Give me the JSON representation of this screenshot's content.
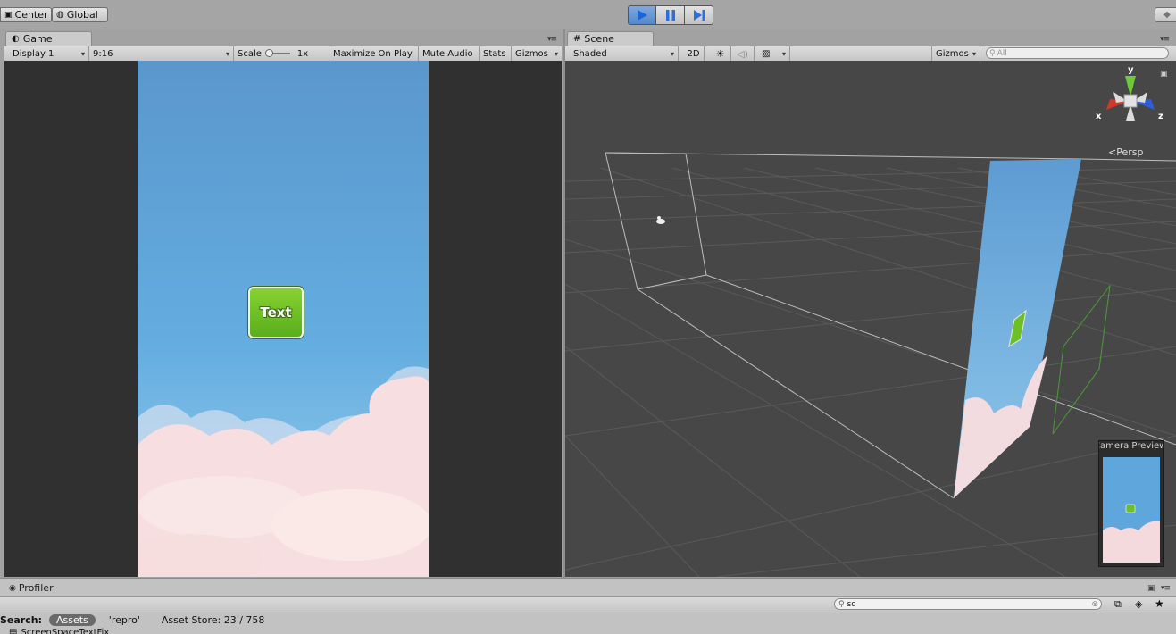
{
  "top_toolbar": {
    "pivot_label": "Center",
    "space_label": "Global",
    "play_icon": "play-icon",
    "pause_icon": "pause-icon",
    "step_icon": "step-icon",
    "accent_color": "#2f7de1"
  },
  "game_panel": {
    "tab_label": "Game",
    "display_label": "Display 1",
    "aspect_label": "9:16",
    "scale_label": "Scale",
    "scale_value": "1x",
    "maximize_label": "Maximize On Play",
    "mute_label": "Mute Audio",
    "stats_label": "Stats",
    "gizmos_label": "Gizmos",
    "button_text": "Text",
    "sky_color": "#5ea6dc",
    "button_color": "#6cbf26"
  },
  "scene_panel": {
    "tab_label": "Scene",
    "shading_label": "Shaded",
    "mode_2d_label": "2D",
    "gizmos_label": "Gizmos",
    "search_placeholder": "All",
    "persp_label": "Persp",
    "axis_y": "y",
    "axis_x": "x",
    "axis_z": "z",
    "camera_preview_label": "Camera Preview",
    "bg_color": "#474747"
  },
  "bottom_panel": {
    "tab_label": "Profiler",
    "search_value": "sc",
    "search_label": "Search:",
    "assets_label": "Assets",
    "repro_label": "'repro'",
    "asset_store_label": "Asset Store: 23 / 758",
    "partial_row": "ScreenSpaceTextFix"
  }
}
